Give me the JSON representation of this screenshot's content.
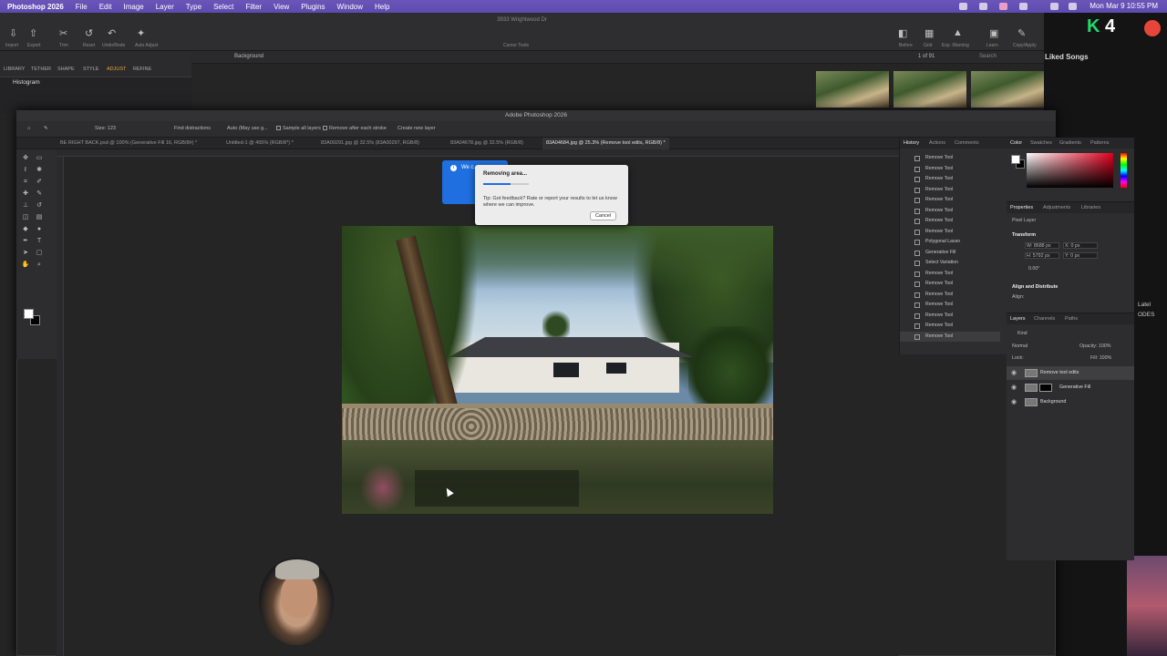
{
  "menubar": {
    "app": "Photoshop 2026",
    "items": [
      "File",
      "Edit",
      "Image",
      "Layer",
      "Type",
      "Select",
      "Filter",
      "View",
      "Plugins",
      "Window",
      "Help"
    ],
    "clock": "Mon Mar 9 10:55 PM"
  },
  "bg_window": {
    "title": "3933 Wrightwood Dr",
    "toolbar_labels": [
      "Import",
      "Export",
      "Trim",
      "Reset",
      "Undo/Redo",
      "Auto Adjust",
      "Cursor Tools",
      "Before",
      "Grid",
      "Exp. Warning",
      "Learn",
      "Copy/Apply"
    ],
    "left_tabs": [
      "LIBRARY",
      "TETHER",
      "SHAPE",
      "STYLE",
      "ADJUST",
      "REFINE"
    ],
    "histogram_label": "Histogram",
    "layer_select": "Background",
    "counter": "1 of 91",
    "search_placeholder": "Search",
    "song_label": "Liked Songs"
  },
  "ps": {
    "title": "Adobe Photoshop 2026",
    "options": {
      "size": "Size: 123",
      "find": "Find distractions",
      "auto": "Auto (May use g...",
      "sample": "Sample all layers",
      "remove_after": "Remove after each stroke",
      "new_layer": "Create new layer"
    },
    "tabs": [
      "BE RIGHT BACK.psd @ 100% (Generative Fill 16, RGB/8#) *",
      "Untitled-1 @ 455% (RGB/8*) *",
      "83A00291.jpg @ 32.5% (83A00297, RGB/8)",
      "83A04678.jpg @ 32.5% (RGB/8)",
      "83A04684.jpg @ 25.3% (Remove tool edits, RGB/8) *"
    ],
    "active_tab_index": 4
  },
  "dialog": {
    "bg_notice": "We c...",
    "title": "Removing area...",
    "progress": 0.6,
    "tip": "Tip:  Got feedback? Rate or report your results to let us know where we can improve.",
    "cancel": "Cancel"
  },
  "history": {
    "tabs": [
      "History",
      "Actions",
      "Comments"
    ],
    "items": [
      "Remove Tool",
      "Remove Tool",
      "Remove Tool",
      "Remove Tool",
      "Remove Tool",
      "Remove Tool",
      "Remove Tool",
      "Remove Tool",
      "Polygonal Lasso",
      "Generative Fill",
      "Select Variation",
      "Remove Tool",
      "Remove Tool",
      "Remove Tool",
      "Remove Tool",
      "Remove Tool",
      "Remove Tool",
      "Remove Tool"
    ],
    "selected_index": 17
  },
  "color_panel": {
    "tabs": [
      "Color",
      "Swatches",
      "Gradients",
      "Patterns"
    ]
  },
  "properties": {
    "tabs": [
      "Properties",
      "Adjustments",
      "Libraries"
    ],
    "layer_type": "Pixel Layer",
    "transform_label": "Transform",
    "w": "W: 8688 px",
    "h": "H: 5792 px",
    "x": "X: 0 px",
    "y": "Y: 0 px",
    "angle": "0.00°",
    "align_label": "Align and Distribute",
    "align_sub": "Align:"
  },
  "layers": {
    "tabs": [
      "Layers",
      "Channels",
      "Paths"
    ],
    "kind": "Kind",
    "blend": "Normal",
    "opacity": "Opacity: 100%",
    "lock": "Lock:",
    "fill": "Fill: 100%",
    "items": [
      {
        "name": "Remove tool edits",
        "selected": true
      },
      {
        "name": "Generative Fill",
        "selected": false
      },
      {
        "name": "Background",
        "selected": false
      }
    ]
  },
  "right_edge": {
    "badge": "K",
    "badge_num": "4",
    "label1": "Latel",
    "label2": "ODES"
  }
}
